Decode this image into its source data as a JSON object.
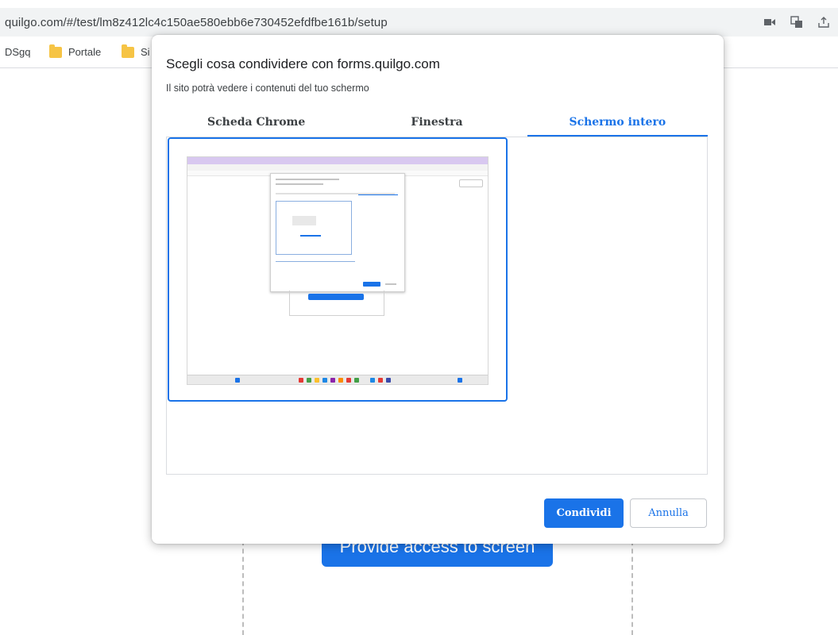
{
  "browser": {
    "url": "quilgo.com/#/test/lm8z412lc4c150ae580ebb6e730452efdfbe161b/setup",
    "icons": [
      "camera-icon",
      "translate-icon",
      "share-icon"
    ]
  },
  "bookmarks": [
    {
      "label": "DSgq"
    },
    {
      "label": "Portale"
    },
    {
      "label": "Si"
    }
  ],
  "page": {
    "provide_button": "Provide access to screen"
  },
  "dialog": {
    "title": "Scegli cosa condividere con forms.quilgo.com",
    "subtitle": "Il sito potrà vedere i contenuti del tuo schermo",
    "tabs": [
      {
        "label": "Scheda Chrome",
        "active": false
      },
      {
        "label": "Finestra",
        "active": false
      },
      {
        "label": "Schermo intero",
        "active": true
      }
    ],
    "share_button": "Condividi",
    "cancel_button": "Annulla"
  },
  "colors": {
    "accent": "#1a73e8",
    "folder": "#f6c445",
    "border": "#dadce0"
  }
}
